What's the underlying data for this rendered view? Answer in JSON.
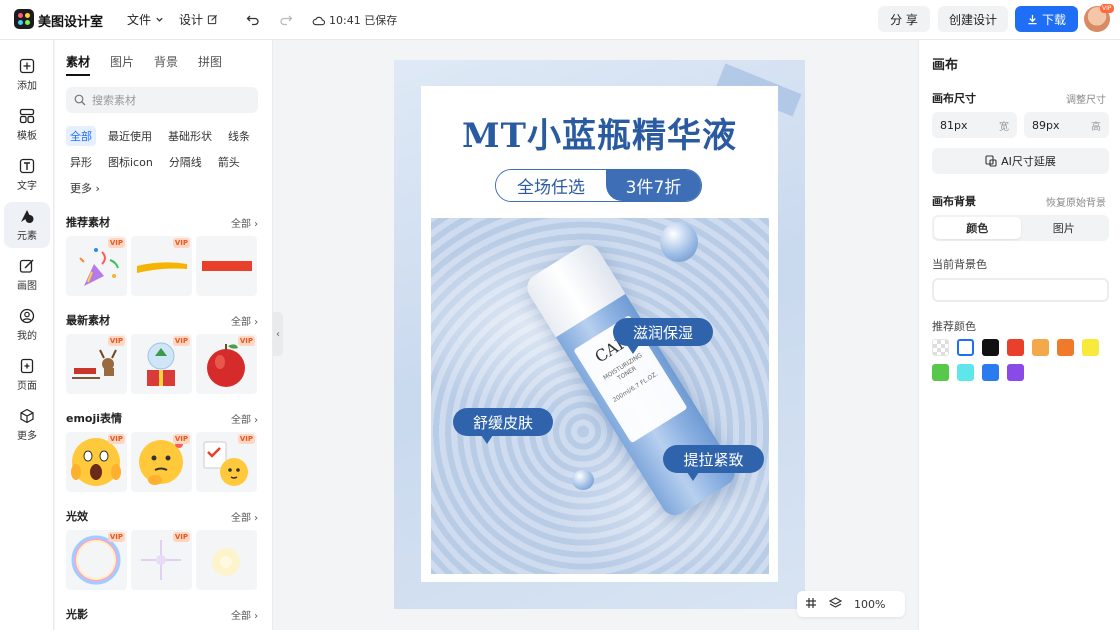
{
  "app": {
    "title": "美图设计室"
  },
  "topbar": {
    "file_label": "文件",
    "design_label": "设计",
    "saved_status": "10:41 已保存",
    "share_label": "分 享",
    "create_label": "创建设计",
    "download_label": "下载",
    "avatar_badge": "VIP"
  },
  "rail": {
    "items": [
      {
        "label": "添加",
        "icon": "plus-square-icon"
      },
      {
        "label": "模板",
        "icon": "template-icon"
      },
      {
        "label": "文字",
        "icon": "text-icon"
      },
      {
        "label": "元素",
        "icon": "shapes-icon"
      },
      {
        "label": "画图",
        "icon": "draw-icon"
      },
      {
        "label": "我的",
        "icon": "user-icon"
      },
      {
        "label": "页面",
        "icon": "page-icon"
      },
      {
        "label": "更多",
        "icon": "cube-icon"
      }
    ]
  },
  "panel": {
    "tabs": [
      "素材",
      "图片",
      "背景",
      "拼图"
    ],
    "search_placeholder": "搜索素材",
    "chips": [
      "全部",
      "最近使用",
      "基础形状",
      "线条",
      "异形",
      "图标icon",
      "分隔线",
      "箭头",
      "更多"
    ],
    "all_label": "全部",
    "vip_label": "VIP",
    "sections": [
      {
        "title": "推荐素材"
      },
      {
        "title": "最新素材"
      },
      {
        "title": "emoji表情"
      },
      {
        "title": "光效"
      },
      {
        "title": "光影"
      }
    ]
  },
  "poster": {
    "title": "MT小蓝瓶精华液",
    "pill_left": "全场任选",
    "pill_right": "3件7折",
    "bottle_brand": "CAK",
    "bottle_sub": "MOISTURIZING TONER",
    "bottle_volume": "200ml/6.7 FL.OZ.",
    "bubble_1": "滋润保湿",
    "bubble_2": "舒缓皮肤",
    "bubble_3": "提拉紧致"
  },
  "zoom": {
    "level": "100%"
  },
  "right_panel": {
    "title": "画布",
    "size_label": "画布尺寸",
    "size_link": "调整尺寸",
    "width_value": "81px",
    "width_unit": "宽",
    "height_value": "89px",
    "height_unit": "高",
    "ai_button": "AI尺寸延展",
    "bg_label": "画布背景",
    "bg_restore": "恢复原始背景",
    "seg_color": "颜色",
    "seg_image": "图片",
    "current_bg_label": "当前背景色",
    "recommend_label": "推荐颜色",
    "swatches": [
      "transparent",
      "#ffffff",
      "#111111",
      "#e8402a",
      "#f3a84a",
      "#f07a2a",
      "#f7ea3a",
      "#58c84a",
      "#5fe6ea",
      "#2a7af0",
      "#8a4ae8"
    ]
  }
}
